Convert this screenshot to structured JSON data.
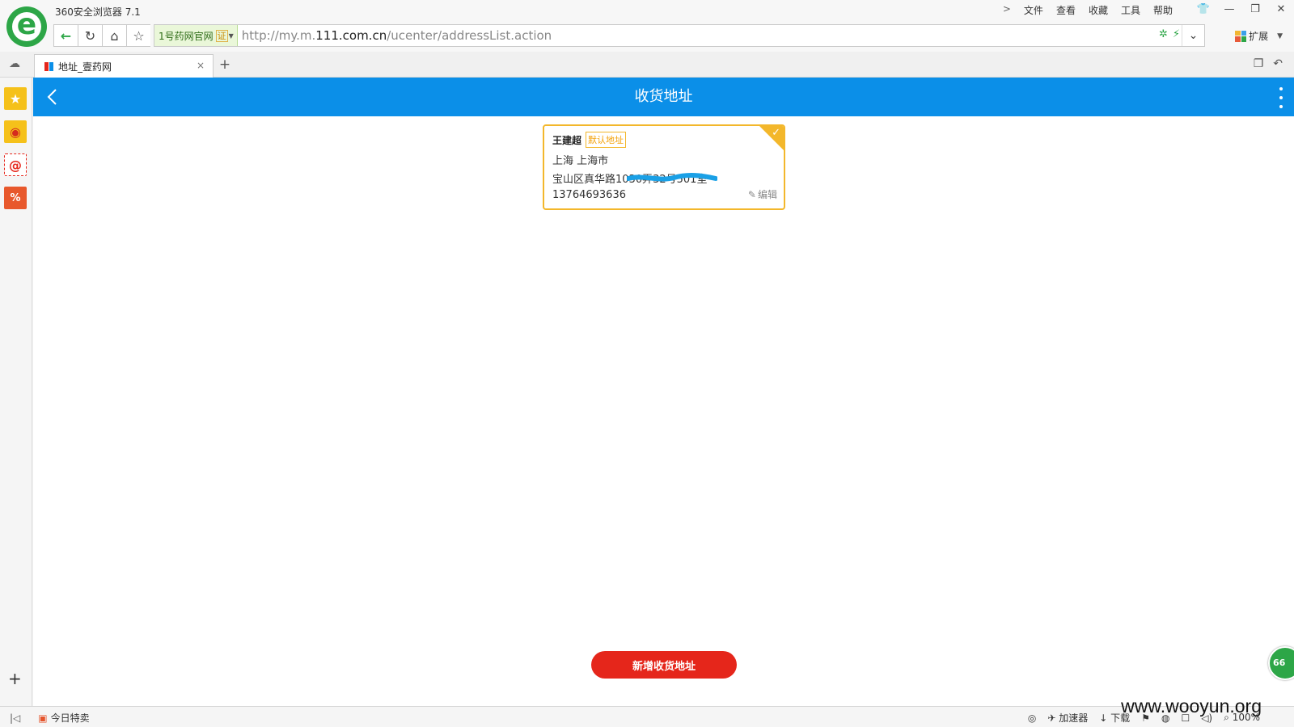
{
  "window": {
    "app_title": "360安全浏览器 7.1",
    "menu_chevron": ">",
    "menu": [
      "文件",
      "查看",
      "收藏",
      "工具",
      "帮助"
    ],
    "buttons": {
      "skin": "👕",
      "minimize": "—",
      "maximize": "❐",
      "close": "✕"
    }
  },
  "nav": {
    "cert_label": "1号药网官网",
    "cert_badge": "证",
    "url_prefix": "http://my.m.",
    "url_domain": "111.com.cn",
    "url_path": "/ucenter/addressList.action",
    "extensions_label": "扩展"
  },
  "tabs": [
    {
      "title": "地址_壹药网",
      "close": "×"
    }
  ],
  "page": {
    "title": "收货地址",
    "address": {
      "name": "王建超",
      "default_badge": "默认地址",
      "region": "上海 上海市",
      "detail": "宝山区真华路1030弄32号501室",
      "phone": "13764693636",
      "edit_label": "编辑"
    },
    "add_button": "新增收货地址",
    "float_badge": "66"
  },
  "statusbar": {
    "today_deal": "今日特卖",
    "accelerator": "加速器",
    "download": "下载",
    "zoom": "100%"
  },
  "watermark": "www.wooyun.org",
  "colors": {
    "header_blue": "#0b8fe8",
    "default_orange": "#f3b72b",
    "add_red": "#e5261b",
    "brand_green": "#2da647",
    "redaction": "#1aa0e6"
  }
}
